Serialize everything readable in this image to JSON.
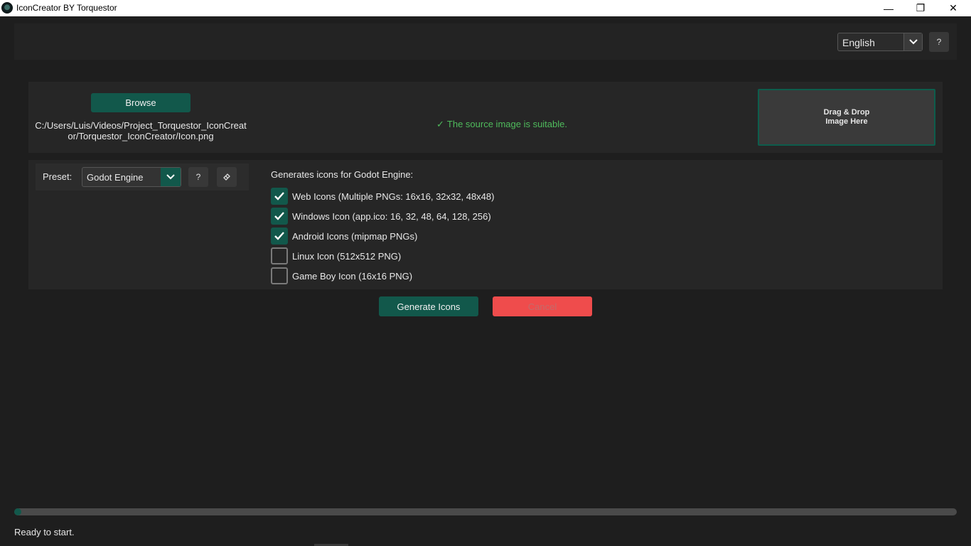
{
  "window": {
    "title": "IconCreator BY Torquestor",
    "minimize_glyph": "—",
    "restore_glyph": "❐",
    "close_glyph": "✕"
  },
  "header": {
    "language": "English",
    "help_label": "?"
  },
  "source": {
    "browse_label": "Browse",
    "file_path": "C:/Users/Luis/Videos/Project_Torquestor_IconCreator/Torquestor_IconCreator/Icon.png",
    "status_check": "✓",
    "status_message": "The source image is suitable.",
    "drop_zone_label": "Drag & Drop\nImage Here"
  },
  "preset": {
    "label": "Preset:",
    "selected": "Godot Engine",
    "help_label": "?",
    "edit_icon": "eraser-icon"
  },
  "options": {
    "heading": "Generates icons for Godot Engine:",
    "items": [
      {
        "label": "Web Icons (Multiple PNGs: 16x16, 32x32, 48x48)",
        "checked": true
      },
      {
        "label": "Windows Icon (app.ico: 16, 32, 48, 64, 128, 256)",
        "checked": true
      },
      {
        "label": "Android Icons (mipmap PNGs)",
        "checked": true
      },
      {
        "label": "Linux Icon (512x512 PNG)",
        "checked": false
      },
      {
        "label": "Game Boy Icon (16x16 PNG)",
        "checked": false
      }
    ]
  },
  "actions": {
    "generate_label": "Generate Icons",
    "cancel_label": "Cancel"
  },
  "progress": {
    "fraction": 0.0
  },
  "status": {
    "text": "Ready to start."
  },
  "colors": {
    "accent": "#12584b",
    "danger": "#ef4c4c",
    "success": "#4fbb5c",
    "background": "#1e1e1e"
  }
}
